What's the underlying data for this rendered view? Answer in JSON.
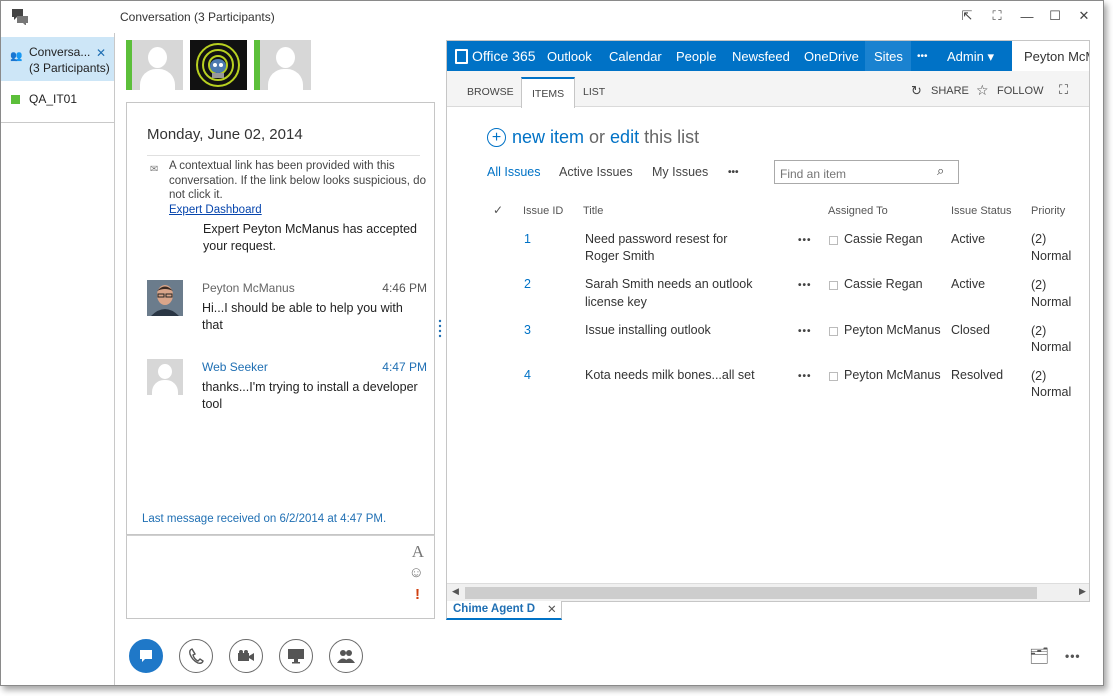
{
  "window": {
    "title": "Conversation (3 Participants)"
  },
  "sidebar": {
    "items": [
      {
        "label_line1": "Conversa...",
        "label_line2": "(3 Participants)"
      },
      {
        "label": "QA_IT01"
      }
    ]
  },
  "conversation": {
    "date": "Monday, June 02, 2014",
    "notice": "A contextual link has been provided with this conversation. If the link below looks suspicious, do not click it.",
    "link_text": "Expert Dashboard",
    "accepted_text": "Expert Peyton McManus has accepted your request.",
    "messages": [
      {
        "name": "Peyton McManus",
        "time": "4:46 PM",
        "text": "Hi...I should be able to help you with that"
      },
      {
        "name": "Web Seeker",
        "time": "4:47 PM",
        "text": "thanks...I'm trying to install a developer tool"
      }
    ],
    "last_received": "Last message received on 6/2/2014 at 4:47 PM."
  },
  "sharepoint": {
    "brand": "Office 365",
    "nav": [
      "Outlook",
      "Calendar",
      "People",
      "Newsfeed",
      "OneDrive",
      "Sites",
      "•••",
      "Admin ▾"
    ],
    "user": "Peyton McManus",
    "ribbon_tabs": [
      "BROWSE",
      "ITEMS",
      "LIST"
    ],
    "ribbon_actions": {
      "share": "SHARE",
      "follow": "FOLLOW"
    },
    "new_item": "new item",
    "or": "or",
    "edit": "edit",
    "this_list": "this list",
    "views": [
      "All Issues",
      "Active Issues",
      "My Issues",
      "•••"
    ],
    "search_placeholder": "Find an item",
    "columns": [
      "Issue ID",
      "Title",
      "Assigned To",
      "Issue Status",
      "Priority"
    ],
    "rows": [
      {
        "id": "1",
        "title_line1": "Need password resest for",
        "title_line2": "Roger Smith",
        "assigned": "Cassie Regan",
        "status": "Active",
        "priority_line1": "(2)",
        "priority_line2": "Normal"
      },
      {
        "id": "2",
        "title_line1": "Sarah Smith needs an outlook",
        "title_line2": "license key",
        "assigned": "Cassie Regan",
        "status": "Active",
        "priority_line1": "(2)",
        "priority_line2": "Normal"
      },
      {
        "id": "3",
        "title_line1": "Issue installing outlook",
        "title_line2": "",
        "assigned": "Peyton McManus",
        "status": "Closed",
        "priority_line1": "(2)",
        "priority_line2": "Normal"
      },
      {
        "id": "4",
        "title_line1": "Kota needs milk bones...all set",
        "title_line2": "",
        "assigned": "Peyton McManus",
        "status": "Resolved",
        "priority_line1": "(2)",
        "priority_line2": "Normal"
      }
    ],
    "row_ellipsis": "•••"
  },
  "bottom_tab": {
    "label": "Chime Agent D",
    "close": "✕"
  },
  "colors": {
    "accent": "#0072c6",
    "presence": "#5cbf3a",
    "selected_tab": "#cde6f7"
  }
}
